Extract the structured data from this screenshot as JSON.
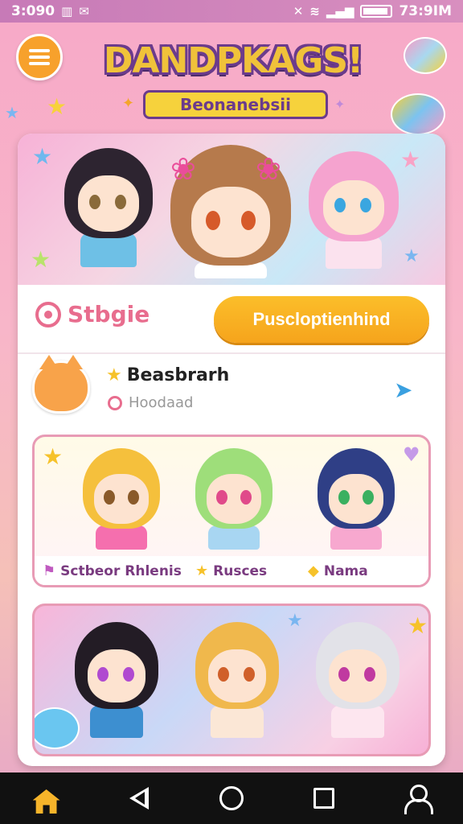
{
  "status_bar": {
    "time_left": "3:090",
    "time_right": "73:9IM",
    "left_icons": [
      "sim-icon",
      "message-icon"
    ],
    "right_icons": [
      "mute-icon",
      "wifi-icon",
      "signal-icon",
      "signal-icon",
      "battery-icon"
    ]
  },
  "header": {
    "menu_icon": "hamburger-icon",
    "title": "DANDPKAGS!",
    "subtitle": "Beonanebsii"
  },
  "stage": {
    "label": "Stbgie",
    "icon": "target-icon",
    "button_label": "Puscloptienhind"
  },
  "list_item": {
    "avatar": "cat-avatar",
    "title": "Beasbrarh",
    "subtitle": "Hoodaad",
    "share_icon": "share-icon"
  },
  "gallery1": {
    "captions": [
      {
        "icon": "flag-icon",
        "label": "Sctbeor Rhlenis"
      },
      {
        "icon": "star-icon",
        "label": "Rusces"
      },
      {
        "icon": "ticket-icon",
        "label": "Nama"
      }
    ]
  },
  "nav": {
    "items": [
      "home-icon",
      "back-icon",
      "circle-home-icon",
      "recent-apps-icon",
      "profile-icon"
    ]
  },
  "colors": {
    "accent_orange": "#f6a41c",
    "accent_pink": "#e86d8e",
    "title_yellow": "#f0c23a",
    "title_outline": "#6b3b8c"
  }
}
